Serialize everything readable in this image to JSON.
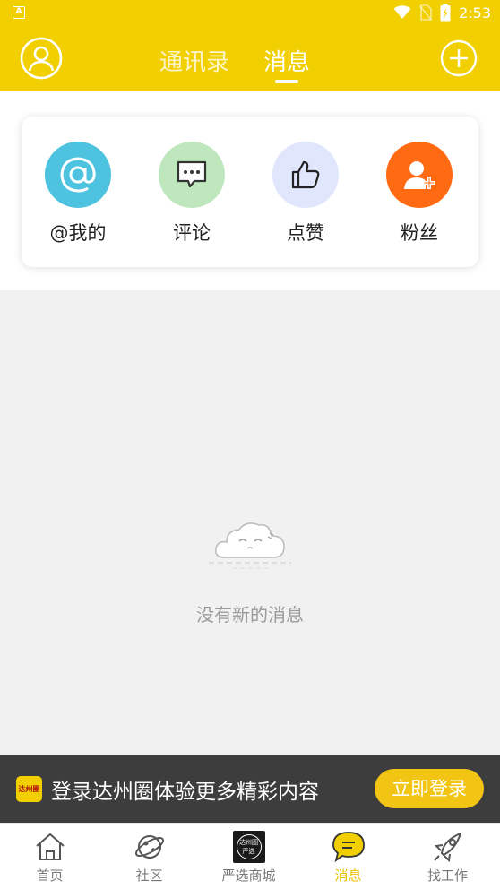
{
  "status_bar": {
    "app_indicator": "A",
    "time": "2:53"
  },
  "header": {
    "tabs": [
      {
        "label": "通讯录",
        "active": false
      },
      {
        "label": "消息",
        "active": true
      }
    ]
  },
  "quick_actions": [
    {
      "label": "@我的",
      "icon": "at-icon",
      "color": "#4ec3e0"
    },
    {
      "label": "评论",
      "icon": "comment-icon",
      "color": "#bfe7be"
    },
    {
      "label": "点赞",
      "icon": "thumbs-up-icon",
      "color": "#e0e6fb"
    },
    {
      "label": "粉丝",
      "icon": "follower-icon",
      "color": "#ff6a12"
    }
  ],
  "empty_state": {
    "message": "没有新的消息"
  },
  "login_banner": {
    "logo_text": "达州圈",
    "text": "登录达州圈体验更多精彩内容",
    "button": "立即登录"
  },
  "bottom_nav": [
    {
      "label": "首页",
      "icon": "home-icon",
      "active": false
    },
    {
      "label": "社区",
      "icon": "planet-icon",
      "active": false
    },
    {
      "label": "严选商城",
      "icon": "mall-logo-icon",
      "logo_line1": "达州圈",
      "logo_line2": "严选",
      "active": false
    },
    {
      "label": "消息",
      "icon": "message-bubble-icon",
      "active": true
    },
    {
      "label": "找工作",
      "icon": "rocket-icon",
      "active": false
    }
  ],
  "colors": {
    "brand_yellow": "#f2cf00",
    "banner_bg": "#3d3d3d",
    "login_button": "#f2c515",
    "active_nav": "#e9bd00"
  }
}
